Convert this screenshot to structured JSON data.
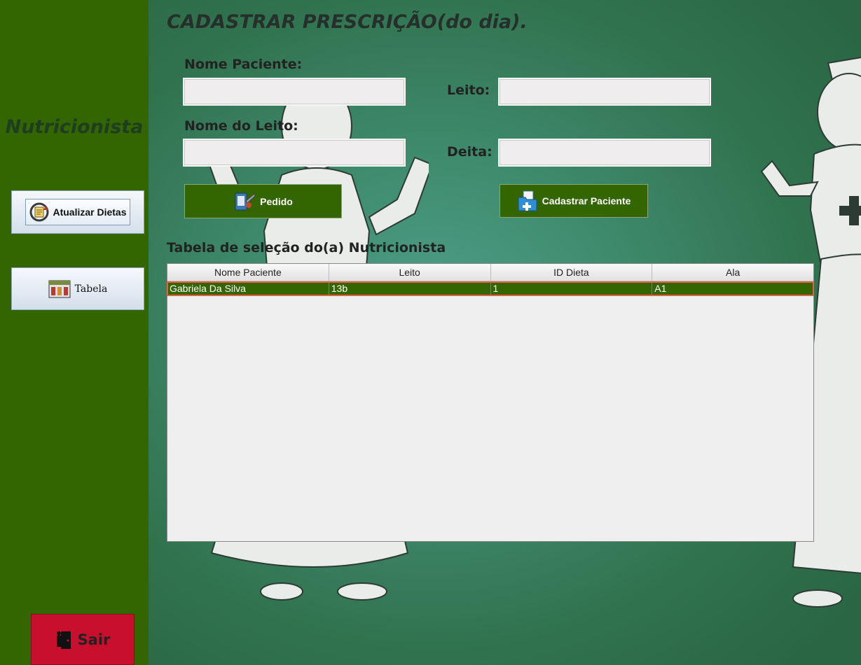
{
  "sidebar": {
    "title": "Nutricionista",
    "buttons": {
      "atualizar": {
        "label": "Atualizar Dietas"
      },
      "tabela": {
        "label": "Tabela"
      },
      "sair": {
        "label": "Sair"
      }
    },
    "colors": {
      "background": "#336600",
      "exit": "#c8102e"
    }
  },
  "main": {
    "title": "CADASTRAR PRESCRIÇÃO(do dia).",
    "form": {
      "nome_paciente_label": "Nome Paciente:",
      "nome_paciente_value": "",
      "nome_leito_label": "Nome do Leito:",
      "nome_leito_value": "",
      "leito_label": "Leito:",
      "leito_value": "",
      "deita_label": "Deita:",
      "deita_value": ""
    },
    "actions": {
      "pedido": "Pedido",
      "cadastrar": "Cadastrar Paciente"
    },
    "table": {
      "label": "Tabela de seleção do(a) Nutricionista",
      "columns": [
        "Nome Paciente",
        "Leito",
        "ID Dieta",
        "Ala"
      ],
      "rows": [
        [
          "Gabriela Da Silva",
          "13b",
          "1",
          "A1"
        ]
      ],
      "selected_row": 0
    }
  },
  "icons": {
    "atualizar": "document-refresh-icon",
    "tabela": "table-icon",
    "sair": "exit-door-icon",
    "pedido": "clipboard-icon",
    "cadastrar": "medical-folder-icon"
  }
}
